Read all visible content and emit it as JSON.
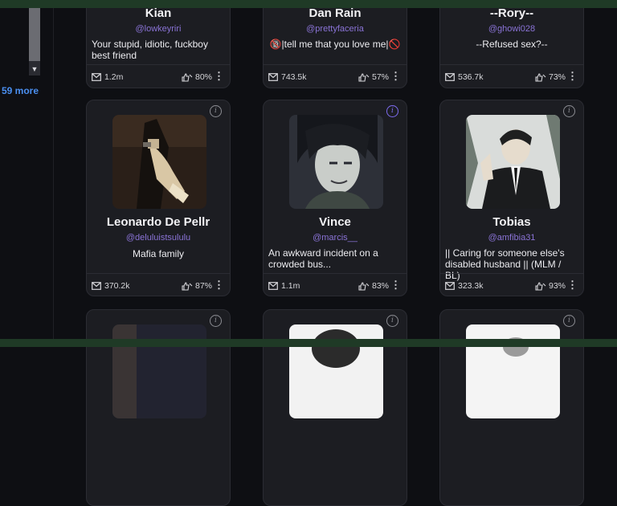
{
  "sidebar": {
    "more_label": "59 more"
  },
  "row1": [
    {
      "name": "Kian",
      "handle": "@lowkeyriri",
      "desc": "Your stupid, idiotic, fuckboy best friend",
      "chats": "1.2m",
      "like": "80%"
    },
    {
      "name": "Dan Rain",
      "handle": "@prettyfaceria",
      "desc": "🔞|tell me that you love me|🚫",
      "chats": "743.5k",
      "like": "57%"
    },
    {
      "name": "--Rory--",
      "handle": "@ghowi028",
      "desc": "--Refused sex?--",
      "chats": "536.7k",
      "like": "73%"
    }
  ],
  "row2": [
    {
      "name": "Leonardo De Pellr",
      "handle": "@deluluistsululu",
      "desc": "Mafia family",
      "chats": "370.2k",
      "like": "87%",
      "avatar": "man-in-suit-holding-heels"
    },
    {
      "name": "Vince",
      "handle": "@marcis__",
      "desc": "An awkward incident on a crowded bus...",
      "chats": "1.1m",
      "like": "83%",
      "avatar": "dark-haired-anime-man-smirking"
    },
    {
      "name": "Tobias",
      "handle": "@amfibia31",
      "desc": "|| Caring for someone else's disabled husband || (MLM / BL)",
      "chats": "323.3k",
      "like": "93%",
      "avatar": "anime-man-in-black-suit"
    }
  ],
  "colors": {
    "accent": "#8a73d6",
    "link": "#4a8ff0",
    "card_bg": "#1c1d22"
  }
}
